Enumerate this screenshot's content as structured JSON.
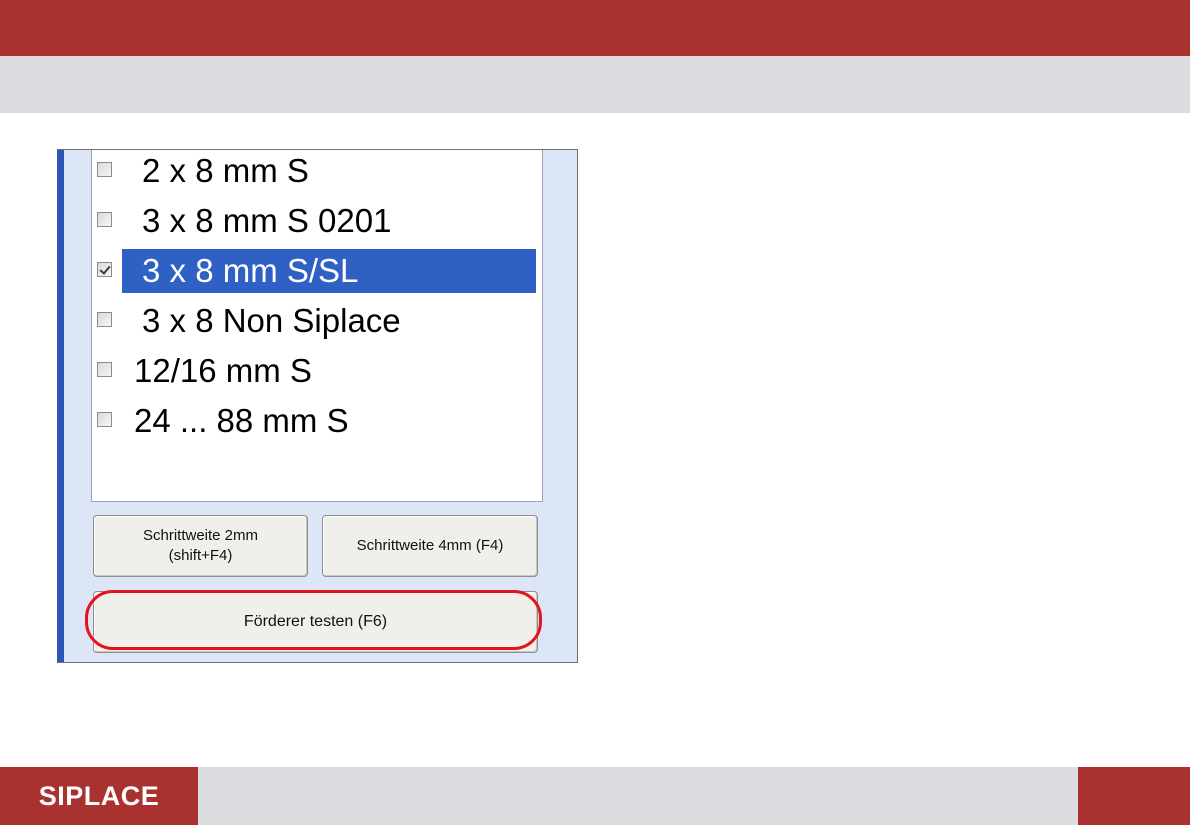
{
  "list": {
    "items": [
      {
        "label": "2 x 8 mm S",
        "checked": false,
        "selected": false
      },
      {
        "label": "3 x 8 mm S 0201",
        "checked": false,
        "selected": false
      },
      {
        "label": "3 x 8 mm S/SL",
        "checked": true,
        "selected": true
      },
      {
        "label": "3 x 8 Non Siplace",
        "checked": false,
        "selected": false
      },
      {
        "label": "12/16 mm S",
        "checked": false,
        "selected": false
      },
      {
        "label": "24 ... 88 mm S",
        "checked": false,
        "selected": false
      }
    ]
  },
  "buttons": {
    "step_2mm_line1": "Schrittweite 2mm",
    "step_2mm_line2": "(shift+F4)",
    "step_4mm": "Schrittweite 4mm (F4)",
    "test_feeder": "Förderer testen (F6)"
  },
  "footer": {
    "brand": "SIPLACE"
  },
  "colors": {
    "brand_red": "#a93130",
    "band_gray": "#dcdbe0",
    "selection_blue": "#2f60c4",
    "highlight_red": "#e3121b"
  }
}
